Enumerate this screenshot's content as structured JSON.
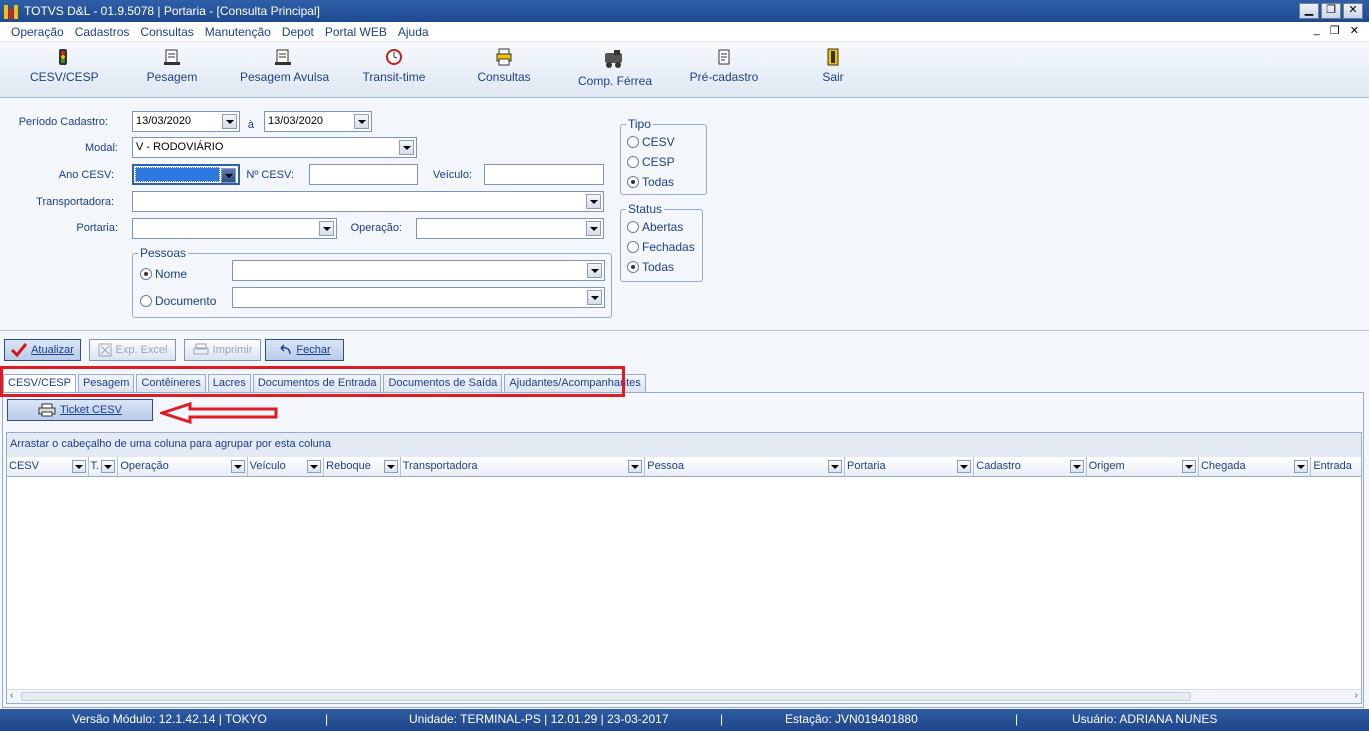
{
  "window": {
    "title": "TOTVS D&L - 01.9.5078 | Portaria - [Consulta Principal]"
  },
  "menu": [
    "Operação",
    "Cadastros",
    "Consultas",
    "Manutenção",
    "Depot",
    "Portal WEB",
    "Ajuda"
  ],
  "toolbar": {
    "cesv": "CESV/CESP",
    "pesagem": "Pesagem",
    "pesagem_avulsa": "Pesagem Avulsa",
    "transit": "Transit-time",
    "consultas": "Consultas",
    "ferrea": "Comp. Férrea",
    "precadastro": "Pré-cadastro",
    "sair": "Sair"
  },
  "filters": {
    "periodo_label": "Período Cadastro:",
    "data_inicio": "13/03/2020",
    "ate_label": "à",
    "data_fim": "13/03/2020",
    "modal_label": "Modal:",
    "modal_value": "V - RODOVIÁRIO",
    "ano_label": "Ano CESV:",
    "ano_value": "",
    "ncesv_label": "Nº CESV:",
    "veiculo_label": "Veículo:",
    "transportadora_label": "Transportadora:",
    "portaria_label": "Portaria:",
    "operacao_label": "Operação:",
    "pessoas_label": "Pessoas",
    "nome_label": "Nome",
    "documento_label": "Documento"
  },
  "tipo": {
    "label": "Tipo",
    "options": [
      "CESV",
      "CESP",
      "Todas"
    ],
    "selected": "Todas"
  },
  "status": {
    "label": "Status",
    "options": [
      "Abertas",
      "Fechadas",
      "Todas"
    ],
    "selected": "Todas"
  },
  "actions": {
    "atualizar": "Atualizar",
    "excel": "Exp. Excel",
    "imprimir": "Imprimir",
    "fechar": "Fechar"
  },
  "tabs": [
    "CESV/CESP",
    "Pesagem",
    "Contêineres",
    "Lacres",
    "Documentos de Entrada",
    "Documentos de Saída",
    "Ajudantes/Acompanhantes"
  ],
  "ticket_button": "Ticket CESV",
  "grid": {
    "group_hint": "Arrastar o cabeçalho de uma coluna para agrupar por esta coluna",
    "columns": [
      "CESV",
      "T.",
      "Operação",
      "Veículo",
      "Reboque",
      "Transportadora",
      "Pessoa",
      "Portaria",
      "Cadastro",
      "Origem",
      "Chegada",
      "Entrada"
    ]
  },
  "statusbar": {
    "versao": "Versão Módulo:  12.1.42.14  |  TOKYO",
    "sep1": "|",
    "unidade": "Unidade: TERMINAL-PS | 12.01.29 | 23-03-2017",
    "sep2": "|",
    "estacao": "Estação: JVN019401880",
    "sep3": "|",
    "usuario": "Usuário: ADRIANA NUNES"
  },
  "colors": {
    "accent": "#1d3f8c",
    "titlebar": "#1f4a90",
    "highlight": "#e01b24"
  }
}
